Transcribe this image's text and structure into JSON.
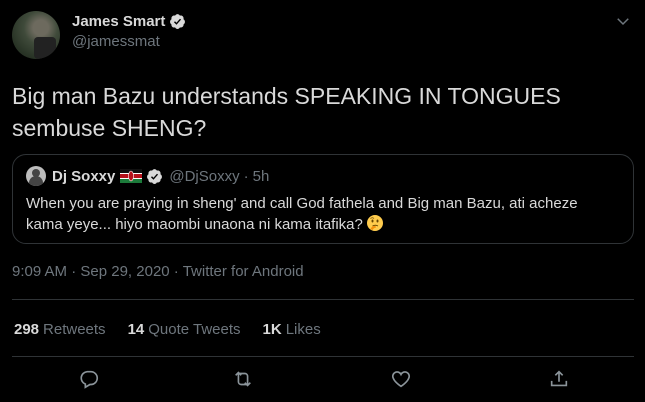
{
  "author": {
    "name": "James Smart",
    "handle": "@jamessmat"
  },
  "tweet": {
    "line1": "Big man Bazu understands SPEAKING IN TONGUES",
    "line2": "sembuse SHENG?"
  },
  "quoted": {
    "name": "Dj Soxxy",
    "handle": "@DjSoxxy",
    "separator": "·",
    "time": "5h",
    "line1": "When you are praying in sheng' and call God fathela and Big man Bazu, ati acheze",
    "line2": "kama yeye... hiyo maombi unaona ni kama itafika?"
  },
  "meta": {
    "time": "9:09 AM",
    "date": "Sep 29, 2020",
    "source": "Twitter for Android",
    "sep": " · "
  },
  "stats": {
    "retweets_num": "298",
    "retweets_lbl": "Retweets",
    "quotes_num": "14",
    "quotes_lbl": "Quote Tweets",
    "likes_num": "1K",
    "likes_lbl": "Likes"
  },
  "colors": {
    "background": "#000000",
    "text": "#d9d9d9",
    "muted": "#6e767d",
    "border": "#2f3336"
  },
  "icons": [
    "verified-badge-icon",
    "chevron-down-icon",
    "kenya-flag-icon",
    "thinking-face-emoji",
    "reply-icon",
    "retweet-icon",
    "like-icon",
    "share-icon"
  ]
}
